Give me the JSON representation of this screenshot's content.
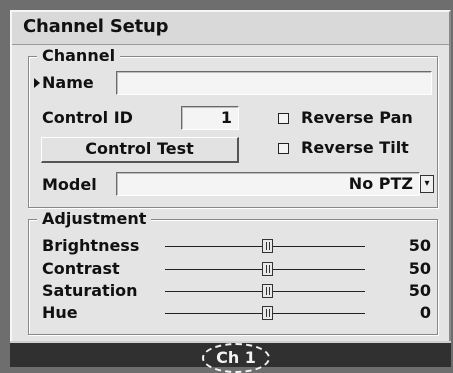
{
  "window": {
    "title": "Channel Setup"
  },
  "channel": {
    "group_title": "Channel",
    "name_label": "Name",
    "name_value": "",
    "control_id_label": "Control ID",
    "control_id_value": "1",
    "control_test_label": "Control Test",
    "reverse_pan_label": "Reverse Pan",
    "reverse_pan_checked": false,
    "reverse_tilt_label": "Reverse Tilt",
    "reverse_tilt_checked": false,
    "model_label": "Model",
    "model_value": "No PTZ"
  },
  "adjustment": {
    "group_title": "Adjustment",
    "sliders": [
      {
        "label": "Brightness",
        "value": "50"
      },
      {
        "label": "Contrast",
        "value": "50"
      },
      {
        "label": "Saturation",
        "value": "50"
      },
      {
        "label": "Hue",
        "value": "0"
      }
    ]
  },
  "statusbar": {
    "channel": "Ch 1"
  },
  "icons": {
    "focus_marker": "triangle-right-icon",
    "dropdown": "chevron-down-icon"
  }
}
